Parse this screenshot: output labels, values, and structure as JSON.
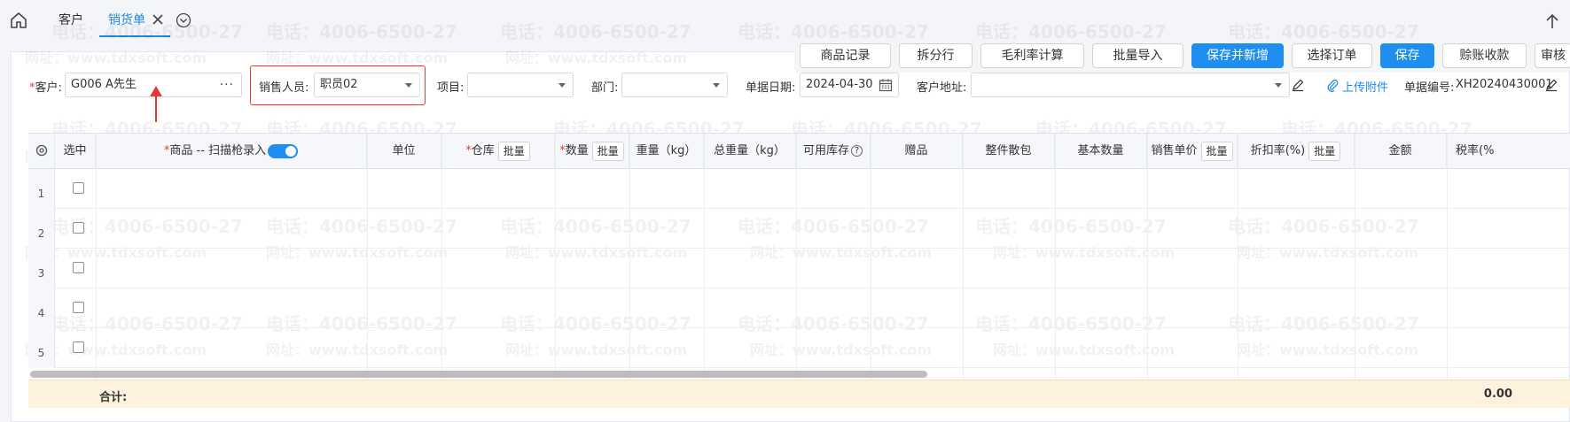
{
  "tabs": [
    {
      "label": "客户"
    },
    {
      "label": "销货单"
    }
  ],
  "toolbar": {
    "buttons": [
      "商品记录",
      "拆分行",
      "毛利率计算",
      "批量导入",
      "保存并新增",
      "选择订单",
      "保存",
      "赊账收款",
      "审核"
    ]
  },
  "form": {
    "customer_label": "客户:",
    "customer_value": "G006 A先生",
    "sales_label": "销售人员:",
    "sales_value": "职员02",
    "project_label": "项目:",
    "dept_label": "部门:",
    "date_label": "单据日期:",
    "date_value": "2024-04-30",
    "address_label": "客户地址:",
    "upload_label": "上传附件",
    "docno_label": "单据编号:",
    "docno_value": "XH20240430001"
  },
  "grid": {
    "columns": {
      "select": "选中",
      "product": "商品 -- 扫描枪录入",
      "unit": "单位",
      "warehouse": "仓库",
      "qty": "数量",
      "weight": "重量（kg）",
      "total_weight": "总重量（kg）",
      "stock": "可用库存",
      "gift": "赠品",
      "pack": "整件散包",
      "base_qty": "基本数量",
      "price": "销售单价",
      "discount": "折扣率(%)",
      "amount": "金额",
      "tax": "税率(%"
    },
    "batch_label": "批量",
    "rows": [
      "1",
      "2",
      "3",
      "4",
      "5"
    ],
    "sum_label": "合计:",
    "sum_amount": "0.00"
  },
  "watermark": {
    "phone": "电话：4006-6500-27",
    "site": "网址：www.tdxsoft.com"
  },
  "colors": {
    "accent": "#1e8ff0",
    "highlight": "#e53935",
    "sum_row": "#fdf3dc"
  }
}
